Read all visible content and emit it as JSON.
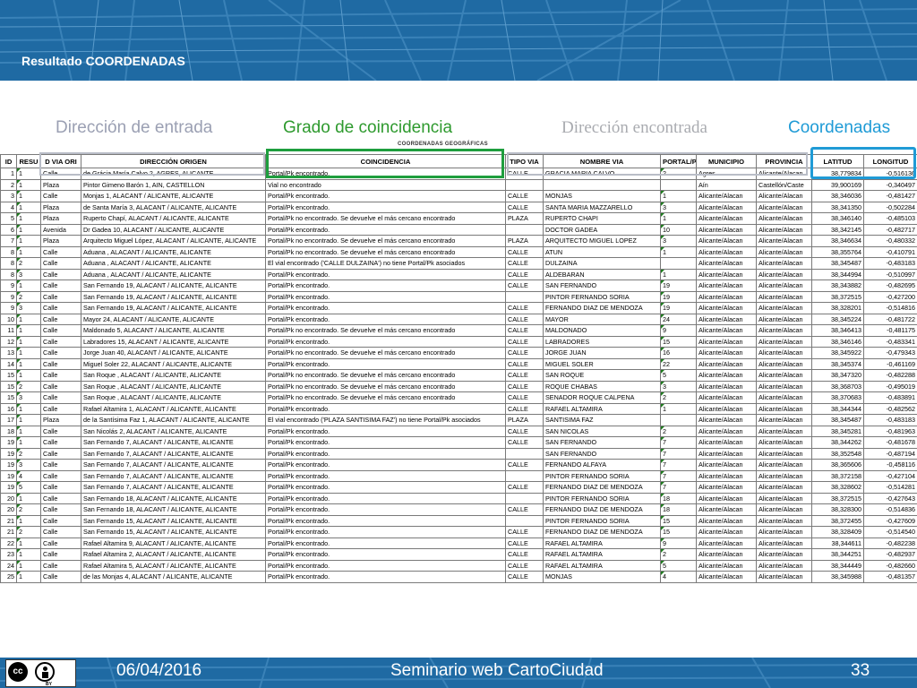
{
  "slide": {
    "title": "Resultado COORDENADAS"
  },
  "labels": {
    "entrada": "Dirección de entrada",
    "grado": "Grado de coincidencia",
    "encontrada": "Dirección encontrada",
    "coordenadas": "Coordenadas"
  },
  "sheet": {
    "group_header": "COORDENADAS GEOGRÁFICAS",
    "columns": [
      "ID",
      "RESU",
      "D VIA ORI",
      "DIRECCIÓN ORIGEN",
      "COINCIDENCIA",
      "TIPO VIA",
      "NOMBRE VIA",
      "PORTAL/P",
      "MUNICIPIO",
      "PROVINCIA",
      "LATITUD",
      "LONGITUD"
    ],
    "rows": [
      [
        "1",
        "1",
        "Calle",
        "de Grácia María Calvo 2, AGRES, ALICANTE",
        "Portal/Pk encontrado.",
        "CALLE",
        "GRACIA MARIA CALVO",
        "2",
        "Agres",
        "Alicante/Alacan",
        "38,779834",
        "-0,516136"
      ],
      [
        "2",
        "1",
        "Plaza",
        "Pintor Gimeno Barón 1, AIN, CASTELLON",
        "Vial no encontrado",
        "",
        "",
        "",
        "Aín",
        "Castellón/Caste",
        "39,900169",
        "-0,340497"
      ],
      [
        "3",
        "1",
        "Calle",
        "Monjas 1, ALACANT / ALICANTE, ALICANTE",
        "Portal/Pk encontrado.",
        "CALLE",
        "MONJAS",
        "1",
        "Alicante/Alacan",
        "Alicante/Alacan",
        "38,346036",
        "-0,481427"
      ],
      [
        "4",
        "1",
        "Plaza",
        "de Santa María 3, ALACANT / ALICANTE, ALICANTE",
        "Portal/Pk encontrado.",
        "CALLE",
        "SANTA MARIA MAZZARELLO",
        "3",
        "Alicante/Alacan",
        "Alicante/Alacan",
        "38,341350",
        "-0,502284"
      ],
      [
        "5",
        "1",
        "Plaza",
        "Ruperto Chapí, ALACANT / ALICANTE, ALICANTE",
        "Portal/Pk no encontrado. Se devuelve el más cercano encontrado",
        "PLAZA",
        "RUPERTO CHAPI",
        "1",
        "Alicante/Alacan",
        "Alicante/Alacan",
        "38,346140",
        "-0,485103"
      ],
      [
        "6",
        "1",
        "Avenida",
        "Dr Gadea 10, ALACANT / ALICANTE, ALICANTE",
        "Portal/Pk encontrado.",
        "",
        "DOCTOR GADEA",
        "10",
        "Alicante/Alacan",
        "Alicante/Alacan",
        "38,342145",
        "-0,482717"
      ],
      [
        "7",
        "1",
        "Plaza",
        "Arquitecto Miguel López, ALACANT / ALICANTE, ALICANTE",
        "Portal/Pk no encontrado. Se devuelve el más cercano encontrado",
        "PLAZA",
        "ARQUITECTO MIGUEL LOPEZ",
        "3",
        "Alicante/Alacan",
        "Alicante/Alacan",
        "38,346634",
        "-0,480332"
      ],
      [
        "8",
        "1",
        "Calle",
        "Aduana , ALACANT / ALICANTE, ALICANTE",
        "Portal/Pk no encontrado. Se devuelve el más cercano encontrado",
        "CALLE",
        "ATUN",
        "1",
        "Alicante/Alacan",
        "Alicante/Alacan",
        "38,355764",
        "-0,410791"
      ],
      [
        "8",
        "2",
        "Calle",
        "Aduana , ALACANT / ALICANTE, ALICANTE",
        "El vial encontrado ('CALLE DULZAINA') no tiene Portal/Pk asociados",
        "CALLE",
        "DULZAINA",
        "",
        "Alicante/Alacan",
        "Alicante/Alacan",
        "38,345487",
        "-0,483183"
      ],
      [
        "8",
        "3",
        "Calle",
        "Aduana , ALACANT / ALICANTE, ALICANTE",
        "Portal/Pk encontrado.",
        "CALLE",
        "ALDEBARAN",
        "1",
        "Alicante/Alacan",
        "Alicante/Alacan",
        "38,344994",
        "-0,510997"
      ],
      [
        "9",
        "1",
        "Calle",
        "San Fernando 19, ALACANT / ALICANTE, ALICANTE",
        "Portal/Pk encontrado.",
        "CALLE",
        "SAN FERNANDO",
        "19",
        "Alicante/Alacan",
        "Alicante/Alacan",
        "38,343882",
        "-0,482695"
      ],
      [
        "9",
        "2",
        "Calle",
        "San Fernando 19, ALACANT / ALICANTE, ALICANTE",
        "Portal/Pk encontrado.",
        "",
        "PINTOR FERNANDO SORIA",
        "19",
        "Alicante/Alacan",
        "Alicante/Alacan",
        "38,372515",
        "-0,427200"
      ],
      [
        "9",
        "3",
        "Calle",
        "San Fernando 19, ALACANT / ALICANTE, ALICANTE",
        "Portal/Pk encontrado.",
        "CALLE",
        "FERNANDO DIAZ DE MENDOZA",
        "19",
        "Alicante/Alacan",
        "Alicante/Alacan",
        "38,328201",
        "-0,514816"
      ],
      [
        "10",
        "1",
        "Calle",
        "Mayor 24, ALACANT / ALICANTE, ALICANTE",
        "Portal/Pk encontrado.",
        "CALLE",
        "MAYOR",
        "24",
        "Alicante/Alacan",
        "Alicante/Alacan",
        "38,345224",
        "-0,481722"
      ],
      [
        "11",
        "1",
        "Calle",
        "Maldonado 5, ALACANT / ALICANTE, ALICANTE",
        "Portal/Pk no encontrado. Se devuelve el más cercano encontrado",
        "CALLE",
        "MALDONADO",
        "9",
        "Alicante/Alacan",
        "Alicante/Alacan",
        "38,346413",
        "-0,481175"
      ],
      [
        "12",
        "1",
        "Calle",
        "Labradores 15, ALACANT / ALICANTE, ALICANTE",
        "Portal/Pk encontrado.",
        "CALLE",
        "LABRADORES",
        "15",
        "Alicante/Alacan",
        "Alicante/Alacan",
        "38,346146",
        "-0,483341"
      ],
      [
        "13",
        "1",
        "Calle",
        "Jorge Juan 40, ALACANT / ALICANTE, ALICANTE",
        "Portal/Pk no encontrado. Se devuelve el más cercano encontrado",
        "CALLE",
        "JORGE JUAN",
        "16",
        "Alicante/Alacan",
        "Alicante/Alacan",
        "38,345922",
        "-0,479343"
      ],
      [
        "14",
        "1",
        "Calle",
        "Miguel Soler 22, ALACANT / ALICANTE, ALICANTE",
        "Portal/Pk encontrado.",
        "CALLE",
        "MIGUEL SOLER",
        "22",
        "Alicante/Alacan",
        "Alicante/Alacan",
        "38,345374",
        "-0,461169"
      ],
      [
        "15",
        "1",
        "Calle",
        "San Roque , ALACANT / ALICANTE, ALICANTE",
        "Portal/Pk no encontrado. Se devuelve el más cercano encontrado",
        "CALLE",
        "SAN ROQUE",
        "5",
        "Alicante/Alacan",
        "Alicante/Alacan",
        "38,347320",
        "-0,482288"
      ],
      [
        "15",
        "2",
        "Calle",
        "San Roque , ALACANT / ALICANTE, ALICANTE",
        "Portal/Pk no encontrado. Se devuelve el más cercano encontrado",
        "CALLE",
        "ROQUE CHABAS",
        "3",
        "Alicante/Alacan",
        "Alicante/Alacan",
        "38,368703",
        "-0,495019"
      ],
      [
        "15",
        "3",
        "Calle",
        "San Roque , ALACANT / ALICANTE, ALICANTE",
        "Portal/Pk no encontrado. Se devuelve el más cercano encontrado",
        "CALLE",
        "SENADOR ROQUE CALPENA",
        "2",
        "Alicante/Alacan",
        "Alicante/Alacan",
        "38,370683",
        "-0,483891"
      ],
      [
        "16",
        "1",
        "Calle",
        "Rafael Altamira 1, ALACANT / ALICANTE, ALICANTE",
        "Portal/Pk encontrado.",
        "CALLE",
        "RAFAEL ALTAMIRA",
        "1",
        "Alicante/Alacan",
        "Alicante/Alacan",
        "38,344344",
        "-0,482562"
      ],
      [
        "17",
        "1",
        "Plaza",
        "de la Santísima Faz 1, ALACANT / ALICANTE, ALICANTE",
        "El vial encontrado ('PLAZA SANTISIMA FAZ') no tiene Portal/Pk asociados",
        "PLAZA",
        "SANTISIMA FAZ",
        "",
        "Alicante/Alacan",
        "Alicante/Alacan",
        "38,345487",
        "-0,483183"
      ],
      [
        "18",
        "1",
        "Calle",
        "San Nicolás 2, ALACANT / ALICANTE, ALICANTE",
        "Portal/Pk encontrado.",
        "CALLE",
        "SAN NICOLAS",
        "2",
        "Alicante/Alacan",
        "Alicante/Alacan",
        "38,345281",
        "-0,481963"
      ],
      [
        "19",
        "1",
        "Calle",
        "San Fernando 7, ALACANT / ALICANTE, ALICANTE",
        "Portal/Pk encontrado.",
        "CALLE",
        "SAN FERNANDO",
        "7",
        "Alicante/Alacan",
        "Alicante/Alacan",
        "38,344262",
        "-0,481678"
      ],
      [
        "19",
        "2",
        "Calle",
        "San Fernando 7, ALACANT / ALICANTE, ALICANTE",
        "Portal/Pk encontrado.",
        "",
        "SAN FERNANDO",
        "7",
        "Alicante/Alacan",
        "Alicante/Alacan",
        "38,352548",
        "-0,487194"
      ],
      [
        "19",
        "3",
        "Calle",
        "San Fernando 7, ALACANT / ALICANTE, ALICANTE",
        "Portal/Pk encontrado.",
        "CALLE",
        "FERNANDO ALFAYA",
        "7",
        "Alicante/Alacan",
        "Alicante/Alacan",
        "38,365606",
        "-0,458116"
      ],
      [
        "19",
        "4",
        "Calle",
        "San Fernando 7, ALACANT / ALICANTE, ALICANTE",
        "Portal/Pk encontrado.",
        "",
        "PINTOR FERNANDO SORIA",
        "7",
        "Alicante/Alacan",
        "Alicante/Alacan",
        "38,372158",
        "-0,427104"
      ],
      [
        "19",
        "5",
        "Calle",
        "San Fernando 7, ALACANT / ALICANTE, ALICANTE",
        "Portal/Pk encontrado.",
        "CALLE",
        "FERNANDO DIAZ DE MENDOZA",
        "7",
        "Alicante/Alacan",
        "Alicante/Alacan",
        "38,328602",
        "-0,514281"
      ],
      [
        "20",
        "1",
        "Calle",
        "San Fernando 18, ALACANT / ALICANTE, ALICANTE",
        "Portal/Pk encontrado.",
        "",
        "PINTOR FERNANDO SORIA",
        "18",
        "Alicante/Alacan",
        "Alicante/Alacan",
        "38,372515",
        "-0,427643"
      ],
      [
        "20",
        "2",
        "Calle",
        "San Fernando 18, ALACANT / ALICANTE, ALICANTE",
        "Portal/Pk encontrado.",
        "CALLE",
        "FERNANDO DIAZ DE MENDOZA",
        "18",
        "Alicante/Alacan",
        "Alicante/Alacan",
        "38,328300",
        "-0,514836"
      ],
      [
        "21",
        "1",
        "Calle",
        "San Fernando 15, ALACANT / ALICANTE, ALICANTE",
        "Portal/Pk encontrado.",
        "",
        "PINTOR FERNANDO SORIA",
        "15",
        "Alicante/Alacan",
        "Alicante/Alacan",
        "38,372455",
        "-0,427609"
      ],
      [
        "21",
        "2",
        "Calle",
        "San Fernando 15, ALACANT / ALICANTE, ALICANTE",
        "Portal/Pk encontrado.",
        "CALLE",
        "FERNANDO DIAZ DE MENDOZA",
        "15",
        "Alicante/Alacan",
        "Alicante/Alacan",
        "38,328409",
        "-0,514540"
      ],
      [
        "22",
        "1",
        "Calle",
        "Rafael Altamira 9, ALACANT / ALICANTE, ALICANTE",
        "Portal/Pk encontrado.",
        "CALLE",
        "RAFAEL ALTAMIRA",
        "9",
        "Alicante/Alacan",
        "Alicante/Alacan",
        "38,344611",
        "-0,482238"
      ],
      [
        "23",
        "1",
        "Calle",
        "Rafael Altamira 2, ALACANT / ALICANTE, ALICANTE",
        "Portal/Pk encontrado.",
        "CALLE",
        "RAFAEL ALTAMIRA",
        "2",
        "Alicante/Alacan",
        "Alicante/Alacan",
        "38,344251",
        "-0,482937"
      ],
      [
        "24",
        "1",
        "Calle",
        "Rafael Altamira 5, ALACANT / ALICANTE, ALICANTE",
        "Portal/Pk encontrado.",
        "CALLE",
        "RAFAEL ALTAMIRA",
        "5",
        "Alicante/Alacan",
        "Alicante/Alacan",
        "38,344449",
        "-0,482660"
      ],
      [
        "25",
        "1",
        "Calle",
        "de las Monjas 4, ALACANT / ALICANTE, ALICANTE",
        "Portal/Pk encontrado.",
        "CALLE",
        "MONJAS",
        "4",
        "Alicante/Alacan",
        "Alicante/Alacan",
        "38,345988",
        "-0,481357"
      ]
    ]
  },
  "footer": {
    "date": "06/04/2016",
    "title": "Seminario web CartoCiudad",
    "page": "33",
    "license_badge": "BY",
    "license_icon": "cc-icon"
  },
  "colors": {
    "header_blue": "#1f6aa3",
    "green_box": "#1e9e3e",
    "blue_box": "#1f9bd6",
    "grey_label": "#9ba0b3"
  }
}
